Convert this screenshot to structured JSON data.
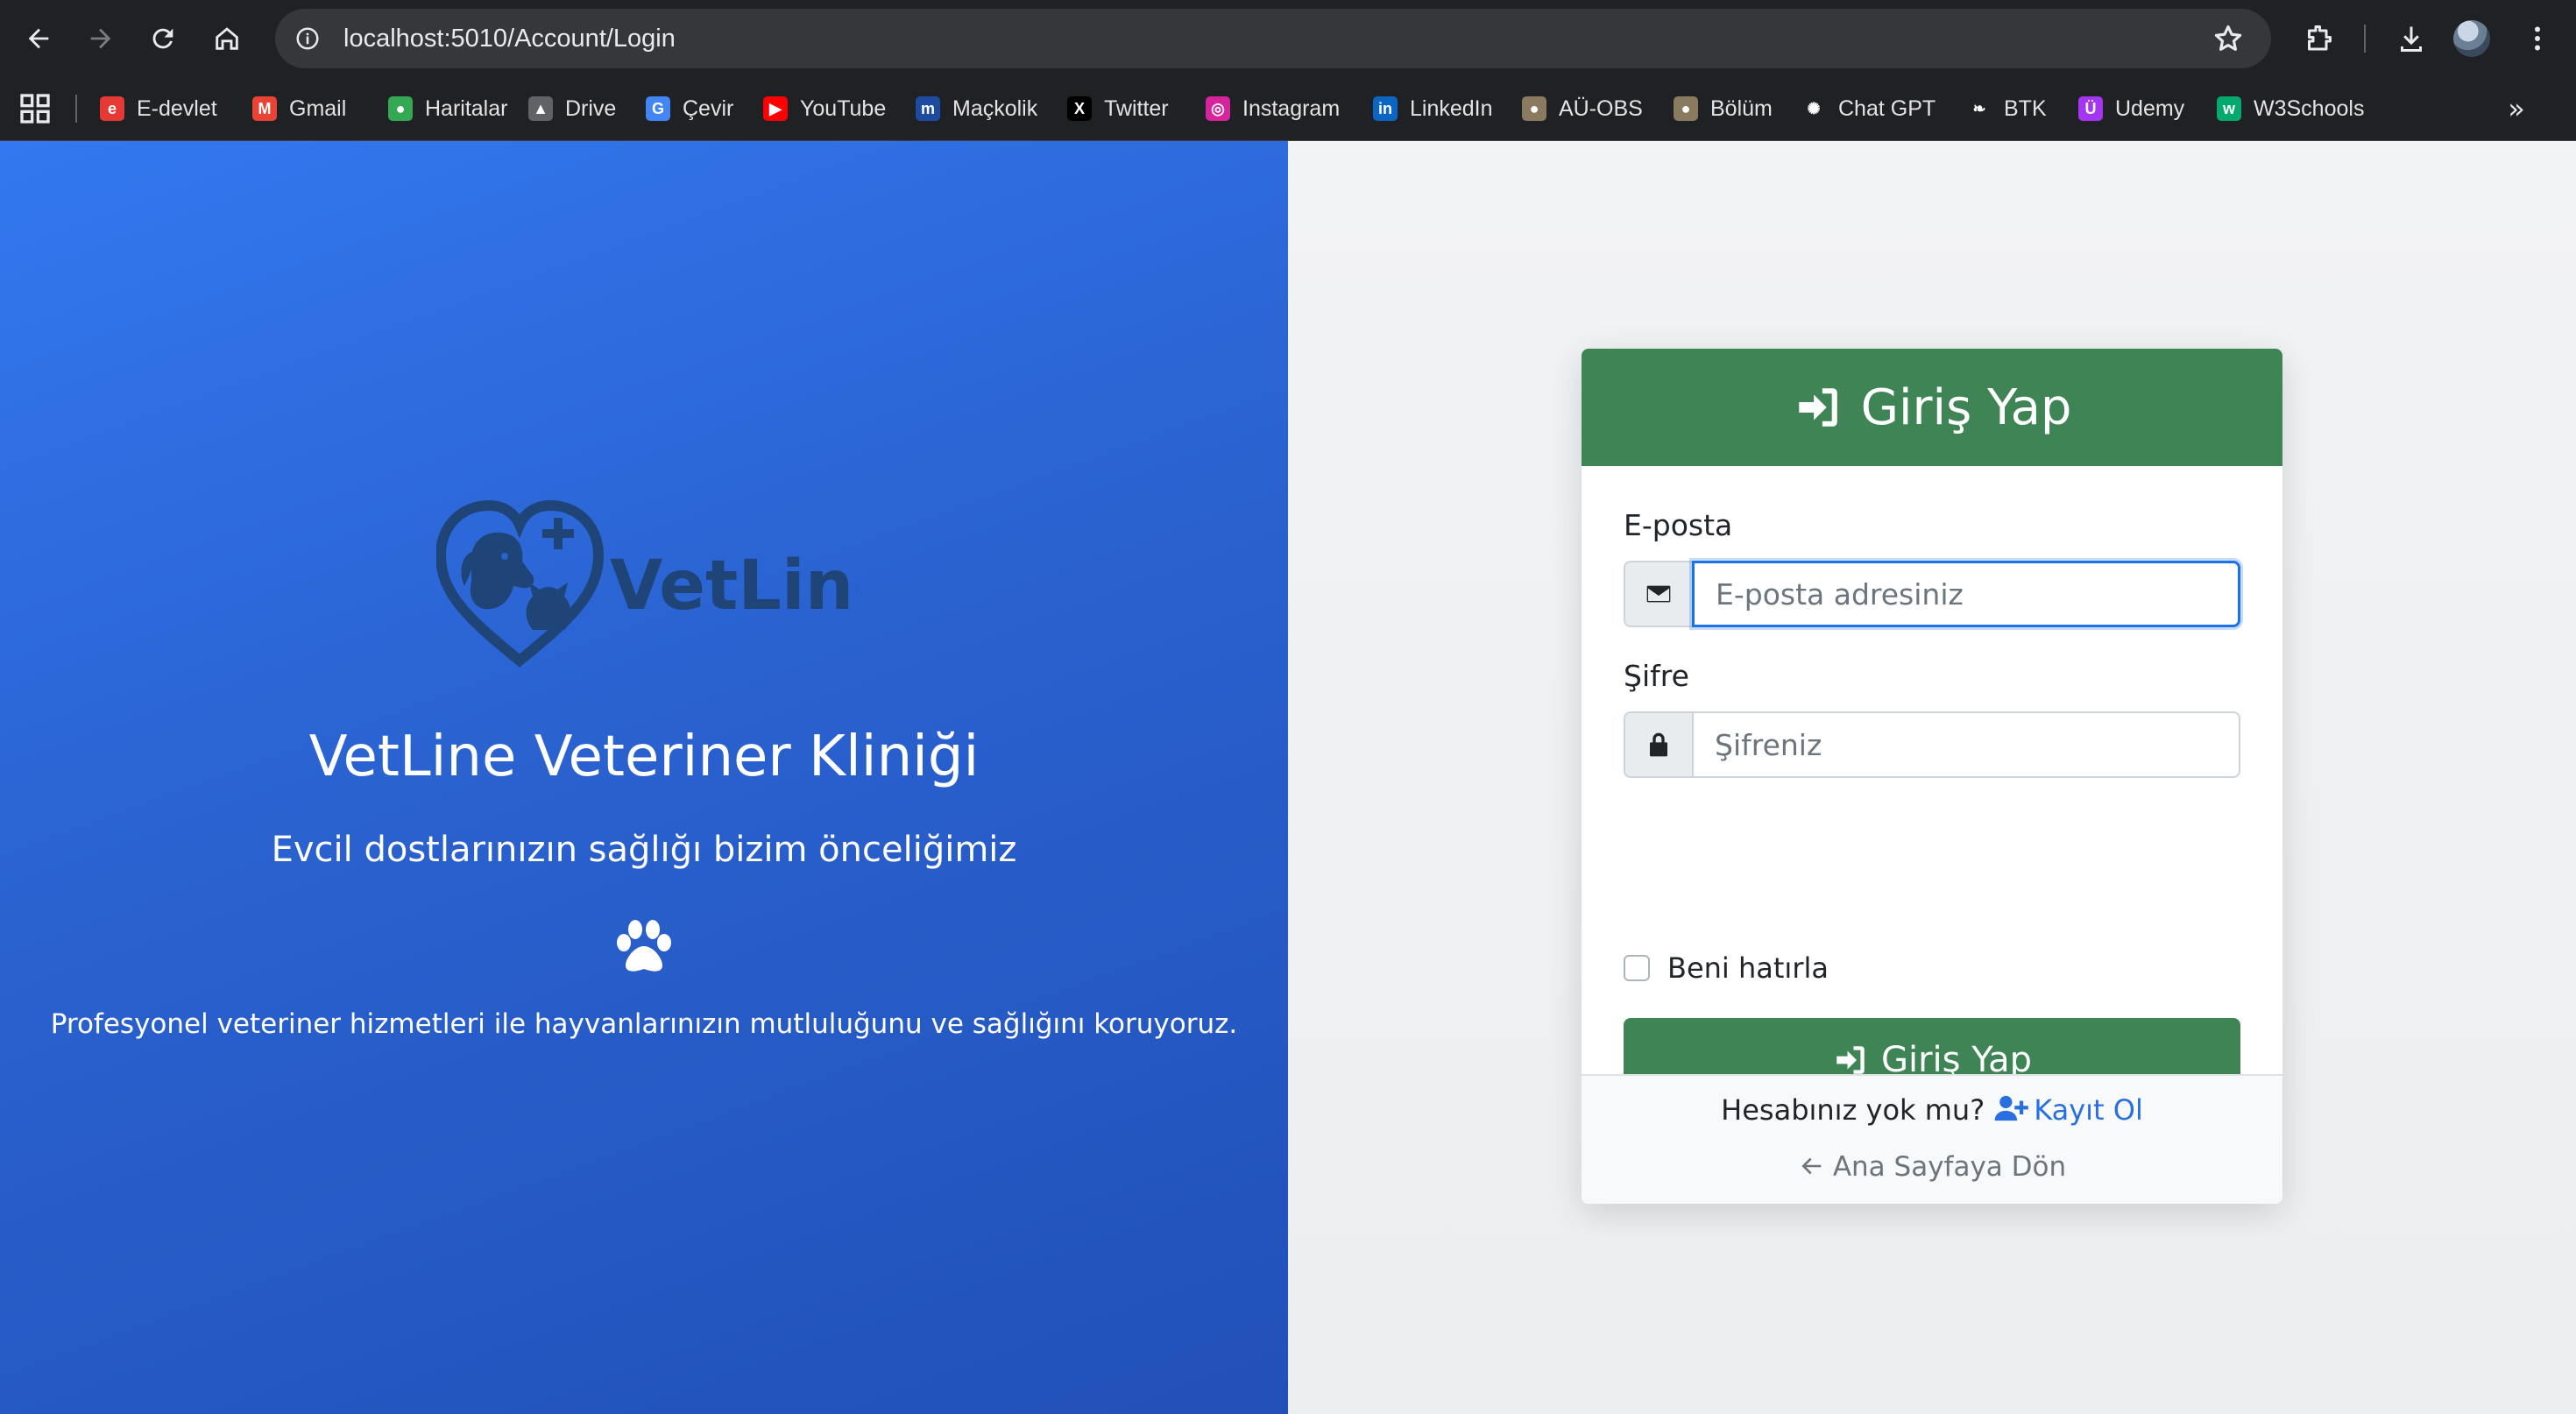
{
  "browser": {
    "url": "localhost:5010/Account/Login",
    "bookmarks": [
      {
        "label": "E-devlet",
        "icon": "edevlet-icon",
        "color": "#e53935",
        "glyph": "e"
      },
      {
        "label": "Gmail",
        "icon": "gmail-icon",
        "color": "#ea4335",
        "glyph": "M"
      },
      {
        "label": "Haritalar",
        "icon": "maps-icon",
        "color": "#34a853",
        "glyph": "●"
      },
      {
        "label": "Drive",
        "icon": "drive-icon",
        "color": "#5f6368",
        "glyph": "▲"
      },
      {
        "label": "Çevir",
        "icon": "translate-icon",
        "color": "#4285f4",
        "glyph": "G"
      },
      {
        "label": "YouTube",
        "icon": "youtube-icon",
        "color": "#ff0000",
        "glyph": "▶"
      },
      {
        "label": "Maçkolik",
        "icon": "mackolik-icon",
        "color": "#1e4aa0",
        "glyph": "m"
      },
      {
        "label": "Twitter",
        "icon": "x-icon",
        "color": "#000000",
        "glyph": "X"
      },
      {
        "label": "Instagram",
        "icon": "instagram-icon",
        "color": "#d6249f",
        "glyph": "◎"
      },
      {
        "label": "LinkedIn",
        "icon": "linkedin-icon",
        "color": "#0a66c2",
        "glyph": "in"
      },
      {
        "label": "AÜ-OBS",
        "icon": "au-obs-icon",
        "color": "#8a7a60",
        "glyph": "●"
      },
      {
        "label": "Bölüm",
        "icon": "bolum-icon",
        "color": "#8a7a60",
        "glyph": "●"
      },
      {
        "label": "Chat GPT",
        "icon": "chatgpt-icon",
        "color": "#202124",
        "glyph": "✺"
      },
      {
        "label": "BTK",
        "icon": "btk-icon",
        "color": "#202124",
        "glyph": "❧"
      },
      {
        "label": "Udemy",
        "icon": "udemy-icon",
        "color": "#a435f0",
        "glyph": "Ü"
      },
      {
        "label": "W3Schools",
        "icon": "w3schools-icon",
        "color": "#04aa6d",
        "glyph": "w"
      }
    ]
  },
  "hero": {
    "logo_text": "VetLine",
    "title": "VetLine Veteriner Kliniği",
    "subtitle": "Evcil dostlarınızın sağlığı bizim önceliğimiz",
    "description": "Profesyonel veteriner hizmetleri ile hayvanlarınızın mutluluğunu ve sağlığını koruyoruz."
  },
  "login": {
    "header": "Giriş Yap",
    "email_label": "E-posta",
    "email_placeholder": "E-posta adresiniz",
    "password_label": "Şifre",
    "password_placeholder": "Şifreniz",
    "remember_label": "Beni hatırla",
    "submit_label": "Giriş Yap",
    "no_account_text": "Hesabınız yok mu?",
    "register_label": "Kayıt Ol",
    "home_label": "Ana Sayfaya Dön"
  },
  "colors": {
    "accent_green": "#3e8455",
    "hero_blue": "#2a62d0",
    "link_blue": "#2a6fe0",
    "logo_navy": "#1f4478"
  }
}
